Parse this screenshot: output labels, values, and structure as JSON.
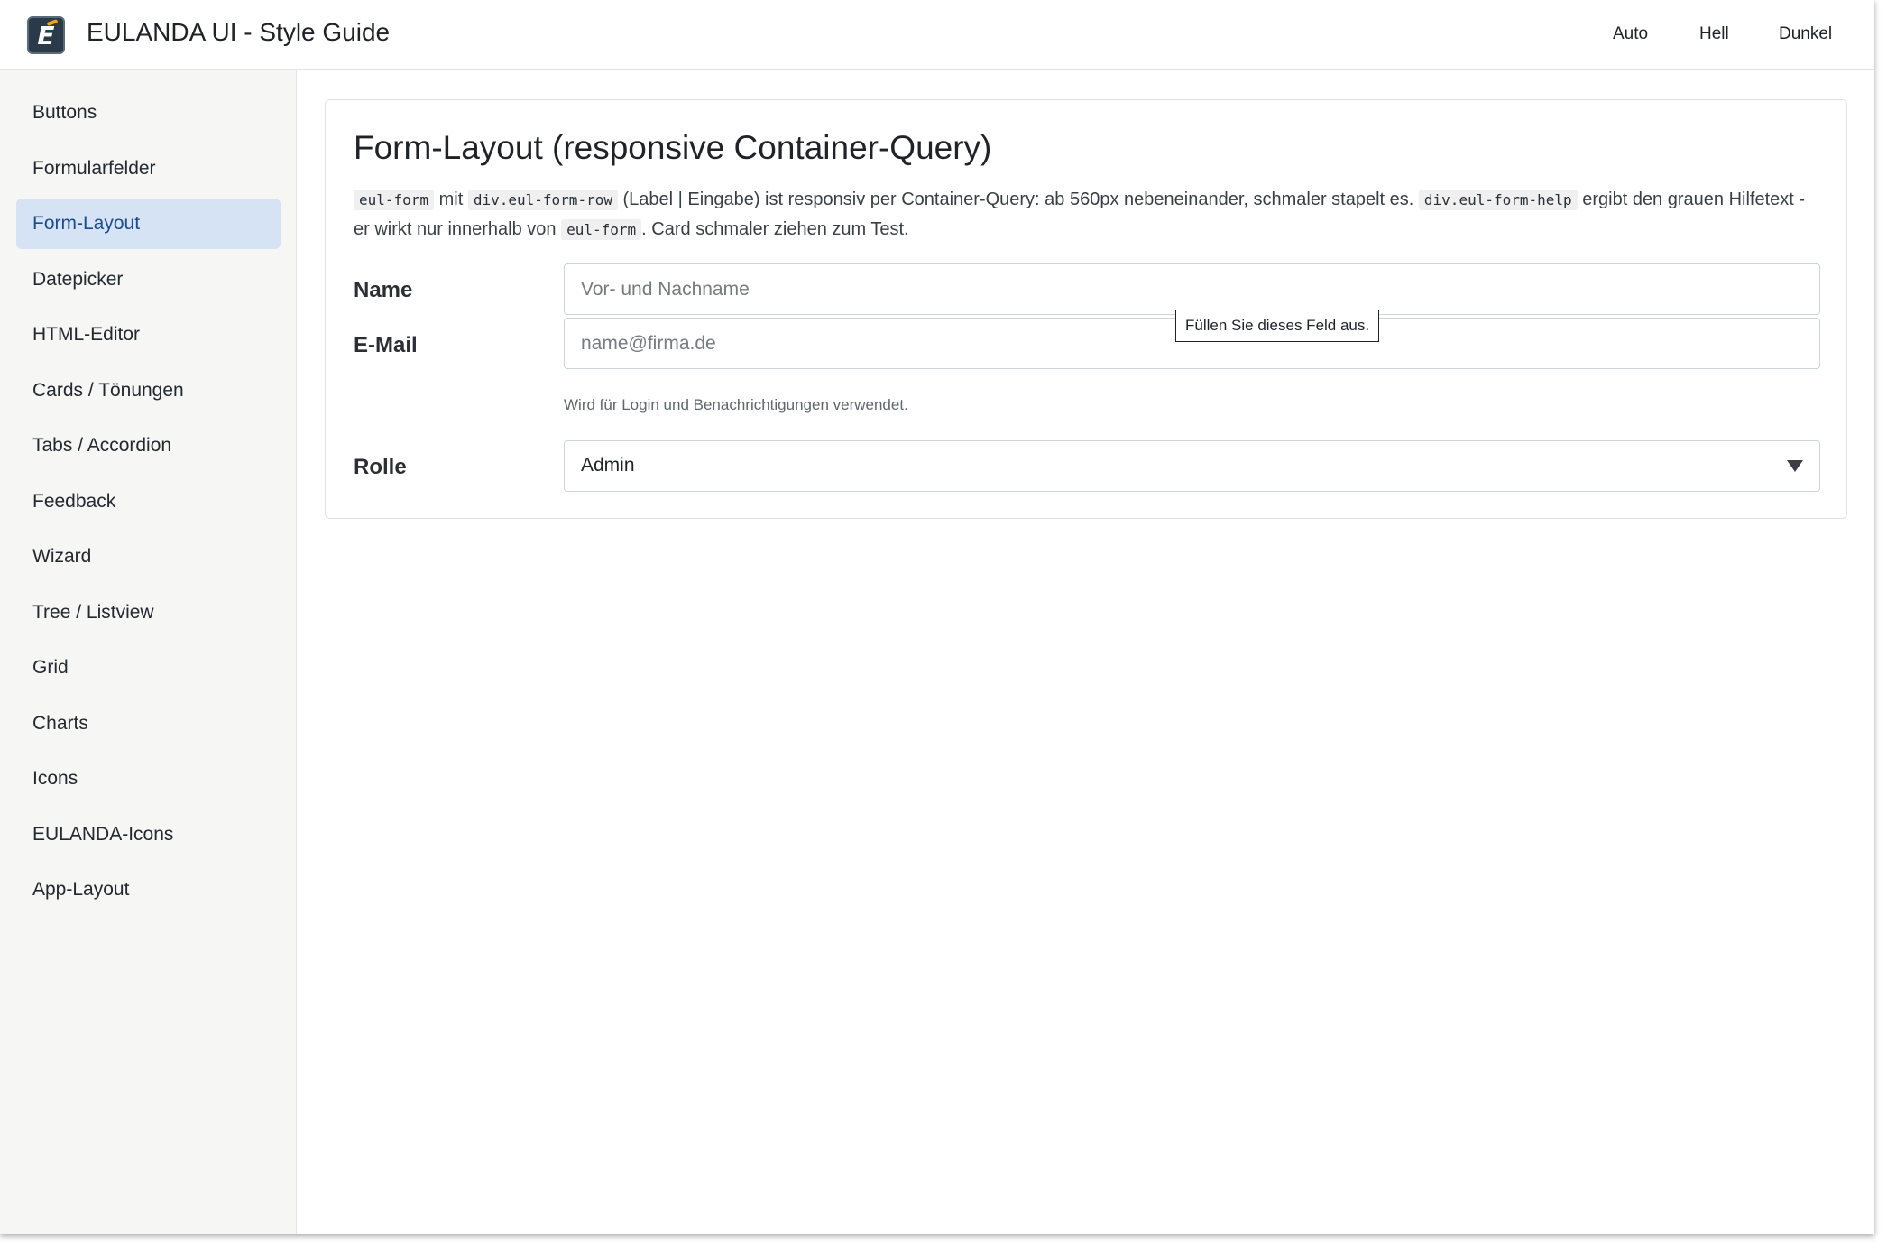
{
  "app": {
    "title": "EULANDA UI - Style Guide",
    "logo_letter": "E"
  },
  "theme_switch": {
    "auto": "Auto",
    "light": "Hell",
    "dark": "Dunkel"
  },
  "sidebar": {
    "active_index": 2,
    "items": [
      {
        "label": "Buttons"
      },
      {
        "label": "Formularfelder"
      },
      {
        "label": "Form-Layout"
      },
      {
        "label": "Datepicker"
      },
      {
        "label": "HTML-Editor"
      },
      {
        "label": "Cards / Tönungen"
      },
      {
        "label": "Tabs / Accordion"
      },
      {
        "label": "Feedback"
      },
      {
        "label": "Wizard"
      },
      {
        "label": "Tree / Listview"
      },
      {
        "label": "Grid"
      },
      {
        "label": "Charts"
      },
      {
        "label": "Icons"
      },
      {
        "label": "EULANDA-Icons"
      },
      {
        "label": "App-Layout"
      }
    ]
  },
  "card": {
    "title": "Form-Layout (responsive Container-Query)",
    "desc": {
      "code1": "eul-form",
      "t1": " mit ",
      "code2": "div.eul-form-row",
      "t2": " (Label | Eingabe) ist responsiv per Container-Query: ab 560px nebeneinander, schmaler stapelt es. ",
      "code3": "div.eul-form-help",
      "t3": " ergibt den grauen Hilfetext - er wirkt nur innerhalb von ",
      "code4": "eul-form",
      "t4": ". Card schmaler ziehen zum Test."
    }
  },
  "form": {
    "name": {
      "label": "Name",
      "value": "",
      "placeholder": "Vor- und Nachname"
    },
    "email": {
      "label": "E-Mail",
      "value": "",
      "placeholder": "name@firma.de",
      "help": "Wird für Login und Benachrichtigungen verwendet."
    },
    "role": {
      "label": "Rolle",
      "selected": "Admin"
    }
  },
  "tooltip": {
    "text": "Füllen Sie dieses Feld aus."
  },
  "colors": {
    "accent_bg": "#d5e3f5",
    "accent_text": "#1a4d8f",
    "sidebar_bg": "#f6f6f5",
    "logo_bg": "#2b3a48",
    "logo_flame": "#f2a51a"
  }
}
